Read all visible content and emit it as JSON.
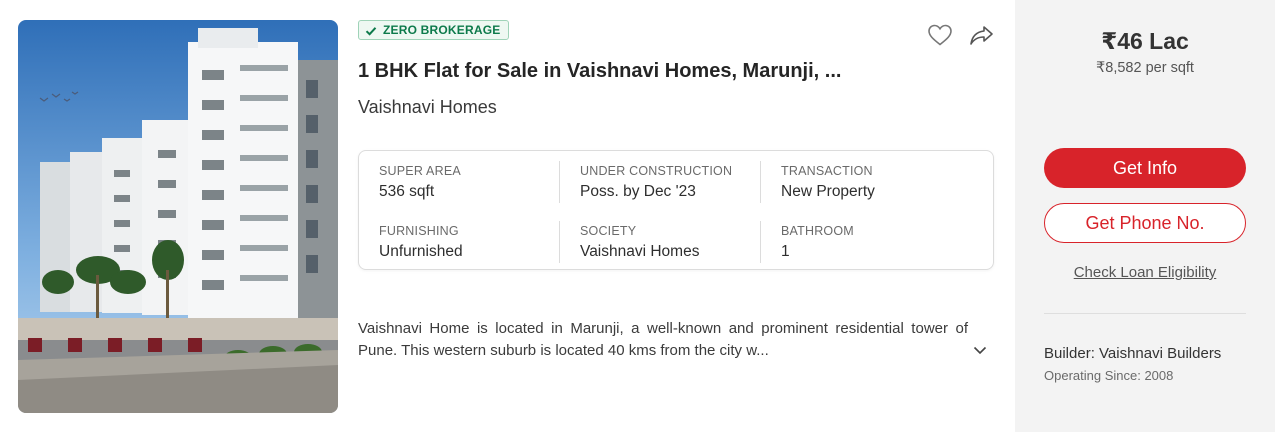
{
  "listing": {
    "badge": "ZERO BROKERAGE",
    "title": "1 BHK Flat for Sale in Vaishnavi Homes, Marunji, ...",
    "society_name": "Vaishnavi Homes",
    "summary": [
      {
        "label": "SUPER AREA",
        "value": "536 sqft"
      },
      {
        "label": "UNDER CONSTRUCTION",
        "value": "Poss. by Dec '23"
      },
      {
        "label": "TRANSACTION",
        "value": "New Property"
      },
      {
        "label": "FURNISHING",
        "value": "Unfurnished"
      },
      {
        "label": "SOCIETY",
        "value": "Vaishnavi Homes"
      },
      {
        "label": "BATHROOM",
        "value": "1"
      }
    ],
    "description": "Vaishnavi Home is located in Marunji, a well-known and prominent residential tower of Pune. This western suburb is located 40 kms from the city w...",
    "icons": {
      "badge": "check-icon",
      "favorite": "heart-icon",
      "share": "share-icon",
      "expand": "chevron-down-icon"
    }
  },
  "pricing": {
    "price": "₹46 Lac",
    "rate": "₹8,582 per sqft",
    "get_info_label": "Get Info",
    "get_phone_label": "Get Phone No.",
    "loan_label": "Check Loan Eligibility",
    "builder": "Builder: Vaishnavi Builders",
    "operating_since": "Operating Since: 2008"
  },
  "colors": {
    "accent": "#d8232a",
    "badge_green": "#0d7a4b",
    "side_panel": "#f3f3f3"
  }
}
